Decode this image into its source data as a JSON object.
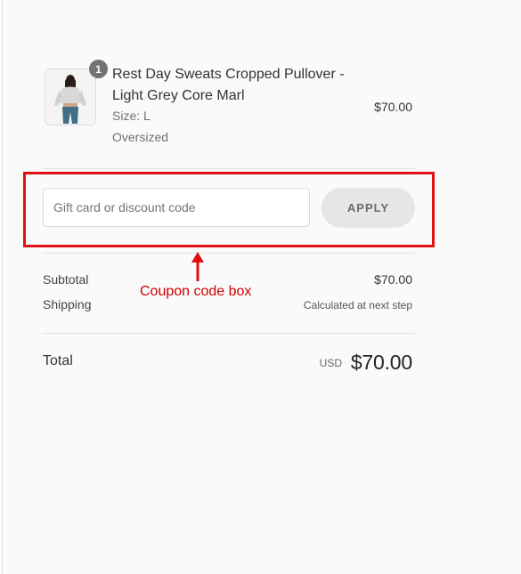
{
  "product": {
    "quantity": "1",
    "name": "Rest Day Sweats Cropped Pullover - Light Grey Core Marl",
    "size": "Size: L",
    "fit": "Oversized",
    "price": "$70.00",
    "thumbnail_icon": "product-photo-icon"
  },
  "discount": {
    "placeholder": "Gift card or discount code",
    "apply_label": "APPLY"
  },
  "totals": {
    "subtotal_label": "Subtotal",
    "subtotal_value": "$70.00",
    "shipping_label": "Shipping",
    "shipping_value": "Calculated at next step",
    "total_label": "Total",
    "currency": "USD",
    "total_value": "$70.00"
  },
  "annotation": {
    "label": "Coupon code box",
    "color": "#e01010"
  }
}
